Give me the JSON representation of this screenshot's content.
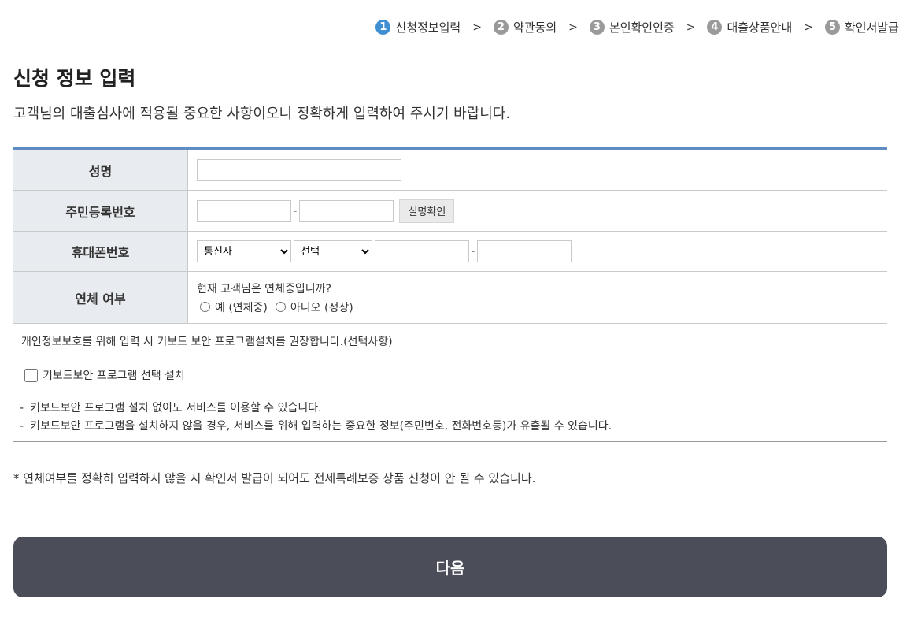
{
  "steps": [
    {
      "num": "1",
      "label": "신청정보입력"
    },
    {
      "num": "2",
      "label": "약관동의"
    },
    {
      "num": "3",
      "label": "본인확인인증"
    },
    {
      "num": "4",
      "label": "대출상품안내"
    },
    {
      "num": "5",
      "label": "확인서발급"
    }
  ],
  "step_separator": ">",
  "active_step": 1,
  "colors": {
    "active_step": "#3f8fd2",
    "table_top_border": "#5e8cc3",
    "next_button": "#4b4d58"
  },
  "page": {
    "title": "신청 정보 입력",
    "description": "고객님의 대출심사에 적용될 중요한 사항이오니 정확하게 입력하여 주시기 바랍니다."
  },
  "form": {
    "name_label": "성명",
    "name_value": "",
    "rrn_label": "주민등록번호",
    "rrn_front_value": "",
    "rrn_back_value": "",
    "rrn_dash": "-",
    "verify_button": "실명확인",
    "phone_label": "휴대폰번호",
    "carrier_selected": "통신사",
    "prefix_selected": "선택",
    "phone_mid_value": "",
    "phone_end_value": "",
    "phone_dash": "-",
    "delinquency_label": "연체 여부",
    "delinquency_question": "현재 고객님은 연체중입니까?",
    "option_yes": "예 (연체중)",
    "option_no": "아니오 (정상)"
  },
  "security": {
    "note": "개인정보보호를 위해 입력 시 키보드 보안 프로그램설치를 권장합니다.(선택사항)",
    "checkbox_label": "키보드보안 프로그램 선택 설치",
    "bullet_1": "키보드보안 프로그램 설치 없이도 서비스를 이용할 수 있습니다.",
    "bullet_2": "키보드보안 프로그램을 설치하지 않을 경우, 서비스를 위해 입력하는 중요한 정보(주민번호, 전화번호등)가 유출될 수 있습니다."
  },
  "footnote": "* 연체여부를 정확히 입력하지 않을 시 확인서 발급이 되어도 전세특례보증 상품 신청이 안 될 수 있습니다.",
  "next_button": "다음"
}
